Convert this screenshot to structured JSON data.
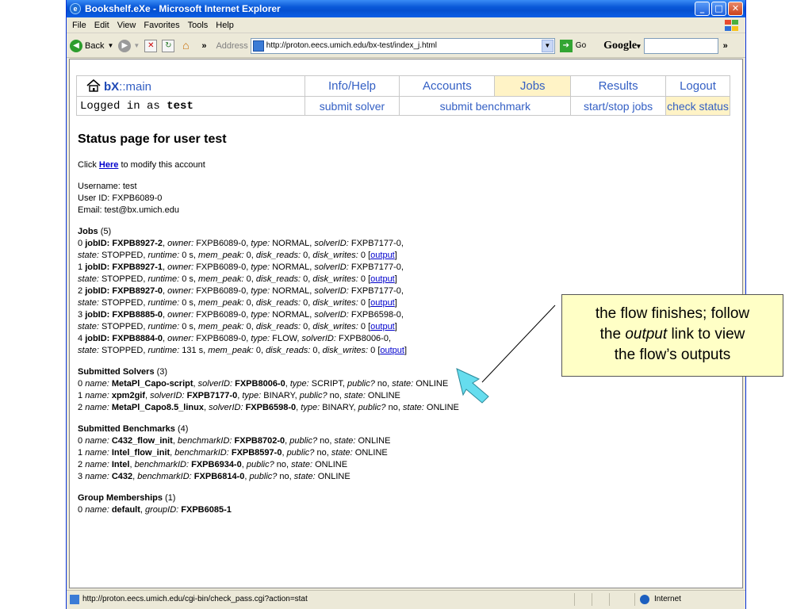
{
  "window": {
    "title": "Bookshelf.eXe - Microsoft Internet Explorer",
    "menu": [
      "File",
      "Edit",
      "View",
      "Favorites",
      "Tools",
      "Help"
    ]
  },
  "toolbar": {
    "back_label": "Back",
    "chevron": "»",
    "address_label": "Address",
    "address_value": "http://proton.eecs.umich.edu/bx-test/index_j.html",
    "go_label": "Go",
    "google_label": "Google"
  },
  "nav": {
    "logo_prefix": "bX",
    "logo_suffix": "::main",
    "top": [
      "Info/Help",
      "Accounts",
      "Jobs",
      "Results",
      "Logout"
    ],
    "logged_in_prefix": "Logged in as",
    "logged_in_user": "test",
    "sub": [
      "submit solver",
      "submit benchmark",
      "start/stop jobs",
      "check status"
    ]
  },
  "page": {
    "title": "Status page for user test",
    "click_prefix": "Click",
    "click_link": "Here",
    "click_suffix": "to modify this account",
    "username": "Username: test",
    "user_id": "User ID: FXPB6089-0",
    "email": "Email: test@bx.umich.edu",
    "jobs_heading": "Jobs",
    "jobs_count": "(5)",
    "jobs": [
      {
        "idx": "0",
        "job_id": "FXPB8927-2",
        "owner": "FXPB6089-0",
        "type": "NORMAL",
        "solver_id": "FXPB7177-0",
        "state": "STOPPED",
        "runtime": "0 s",
        "mem_peak": "0",
        "disk_reads": "0",
        "disk_writes": "0"
      },
      {
        "idx": "1",
        "job_id": "FXPB8927-1",
        "owner": "FXPB6089-0",
        "type": "NORMAL",
        "solver_id": "FXPB7177-0",
        "state": "STOPPED",
        "runtime": "0 s",
        "mem_peak": "0",
        "disk_reads": "0",
        "disk_writes": "0"
      },
      {
        "idx": "2",
        "job_id": "FXPB8927-0",
        "owner": "FXPB6089-0",
        "type": "NORMAL",
        "solver_id": "FXPB7177-0",
        "state": "STOPPED",
        "runtime": "0 s",
        "mem_peak": "0",
        "disk_reads": "0",
        "disk_writes": "0"
      },
      {
        "idx": "3",
        "job_id": "FXPB8885-0",
        "owner": "FXPB6089-0",
        "type": "NORMAL",
        "solver_id": "FXPB6598-0",
        "state": "STOPPED",
        "runtime": "0 s",
        "mem_peak": "0",
        "disk_reads": "0",
        "disk_writes": "0"
      },
      {
        "idx": "4",
        "job_id": "FXPB8884-0",
        "owner": "FXPB6089-0",
        "type": "FLOW",
        "solver_id": "FXPB8006-0",
        "state": "STOPPED",
        "runtime": "131 s",
        "mem_peak": "0",
        "disk_reads": "0",
        "disk_writes": "0"
      }
    ],
    "output_link": "output",
    "solvers_heading": "Submitted Solvers",
    "solvers_count": "(3)",
    "solvers": [
      {
        "idx": "0",
        "name": "MetaPl_Capo-script",
        "solver_id": "FXPB8006-0",
        "type": "SCRIPT",
        "public": "no",
        "state": "ONLINE"
      },
      {
        "idx": "1",
        "name": "xpm2gif",
        "solver_id": "FXPB7177-0",
        "type": "BINARY",
        "public": "no",
        "state": "ONLINE"
      },
      {
        "idx": "2",
        "name": "MetaPl_Capo8.5_linux",
        "solver_id": "FXPB6598-0",
        "type": "BINARY",
        "public": "no",
        "state": "ONLINE"
      }
    ],
    "benchmarks_heading": "Submitted Benchmarks",
    "benchmarks_count": "(4)",
    "benchmarks": [
      {
        "idx": "0",
        "name": "C432_flow_init",
        "benchmark_id": "FXPB8702-0",
        "public": "no",
        "state": "ONLINE"
      },
      {
        "idx": "1",
        "name": "Intel_flow_init",
        "benchmark_id": "FXPB8597-0",
        "public": "no",
        "state": "ONLINE"
      },
      {
        "idx": "2",
        "name": "Intel",
        "benchmark_id": "FXPB6934-0",
        "public": "no",
        "state": "ONLINE"
      },
      {
        "idx": "3",
        "name": "C432",
        "benchmark_id": "FXPB6814-0",
        "public": "no",
        "state": "ONLINE"
      }
    ],
    "groups_heading": "Group Memberships",
    "groups_count": "(1)",
    "groups": [
      {
        "idx": "0",
        "name": "default",
        "group_id": "FXPB6085-1"
      }
    ]
  },
  "statusbar": {
    "url": "http://proton.eecs.umich.edu/cgi-bin/check_pass.cgi?action=stat",
    "zone": "Internet"
  },
  "callout": {
    "line1": "the flow finishes; follow",
    "line2_pre": "the",
    "line2_em": "output",
    "line2_post": "link to view",
    "line3": "the flow’s outputs"
  },
  "colors": {
    "nav_link": "#335fc4",
    "active_tab": "#fff3c6",
    "callout_bg": "#ffffc6",
    "arrow": "#66ddee"
  }
}
